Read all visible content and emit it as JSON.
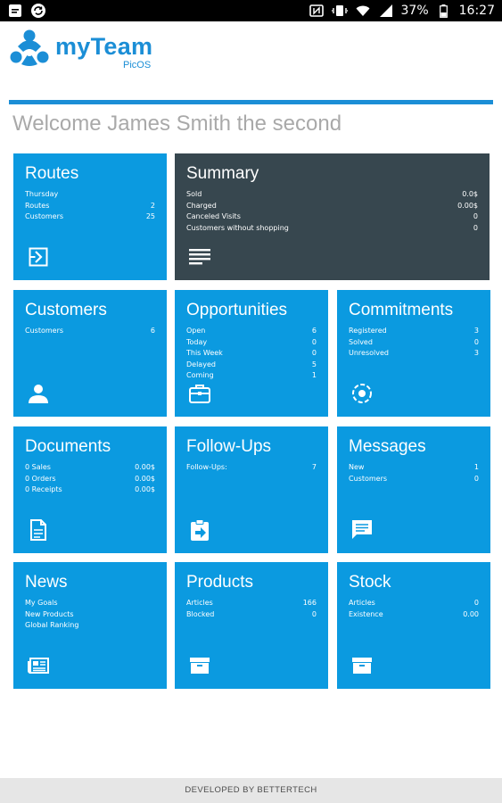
{
  "status_bar": {
    "battery": "37%",
    "time": "16:27",
    "icons": [
      "notification-icon",
      "sync-icon",
      "nfc-icon",
      "vibrate-icon",
      "wifi-icon",
      "signal-icon",
      "battery-icon"
    ]
  },
  "header": {
    "app_name": "myTeam",
    "app_sub": "PicOS",
    "accent": "#1b8ed6"
  },
  "welcome": "Welcome James Smith the second",
  "tiles": {
    "routes": {
      "title": "Routes",
      "rows": [
        {
          "label": "Thursday",
          "value": ""
        },
        {
          "label": "Routes",
          "value": "2"
        },
        {
          "label": "Customers",
          "value": "25"
        }
      ],
      "icon": "route-icon"
    },
    "summary": {
      "title": "Summary",
      "rows": [
        {
          "label": "Sold",
          "value": "0.0$"
        },
        {
          "label": "Charged",
          "value": "0.00$"
        },
        {
          "label": "Canceled Visits",
          "value": "0"
        },
        {
          "label": "Customers without shopping",
          "value": "0"
        }
      ],
      "icon": "list-icon"
    },
    "customers": {
      "title": "Customers",
      "rows": [
        {
          "label": "Customers",
          "value": "6"
        }
      ],
      "icon": "person-icon"
    },
    "opportunities": {
      "title": "Opportunities",
      "rows": [
        {
          "label": "Open",
          "value": "6"
        },
        {
          "label": "Today",
          "value": "0"
        },
        {
          "label": "This Week",
          "value": "0"
        },
        {
          "label": "Delayed",
          "value": "5"
        },
        {
          "label": "Coming",
          "value": "1"
        }
      ],
      "icon": "briefcase-icon"
    },
    "commitments": {
      "title": "Commitments",
      "rows": [
        {
          "label": "Registered",
          "value": "3"
        },
        {
          "label": "Solved",
          "value": "0"
        },
        {
          "label": "Unresolved",
          "value": "3"
        }
      ],
      "icon": "target-icon"
    },
    "documents": {
      "title": "Documents",
      "rows": [
        {
          "label": "0 Sales",
          "value": "0.00$"
        },
        {
          "label": "0 Orders",
          "value": "0.00$"
        },
        {
          "label": "0 Receipts",
          "value": "0.00$"
        }
      ],
      "icon": "document-icon"
    },
    "followups": {
      "title": "Follow-Ups",
      "rows": [
        {
          "label": "Follow-Ups:",
          "value": "7"
        }
      ],
      "icon": "clipboard-arrow-icon"
    },
    "messages": {
      "title": "Messages",
      "rows": [
        {
          "label": "New",
          "value": "1"
        },
        {
          "label": "Customers",
          "value": "0"
        }
      ],
      "icon": "message-icon"
    },
    "news": {
      "title": "News",
      "rows": [
        {
          "label": "My Goals",
          "value": ""
        },
        {
          "label": "New Products",
          "value": ""
        },
        {
          "label": "Global Ranking",
          "value": ""
        }
      ],
      "icon": "newspaper-icon"
    },
    "products": {
      "title": "Products",
      "rows": [
        {
          "label": "Articles",
          "value": "166"
        },
        {
          "label": "Blocked",
          "value": "0"
        }
      ],
      "icon": "box-icon"
    },
    "stock": {
      "title": "Stock",
      "rows": [
        {
          "label": "Articles",
          "value": "0"
        },
        {
          "label": "Existence",
          "value": "0.00"
        }
      ],
      "icon": "box-icon"
    }
  },
  "colors": {
    "tile_blue": "#0b9ae0",
    "tile_dark": "#37474f"
  },
  "footer": "DEVELOPED BY BETTERTECH"
}
